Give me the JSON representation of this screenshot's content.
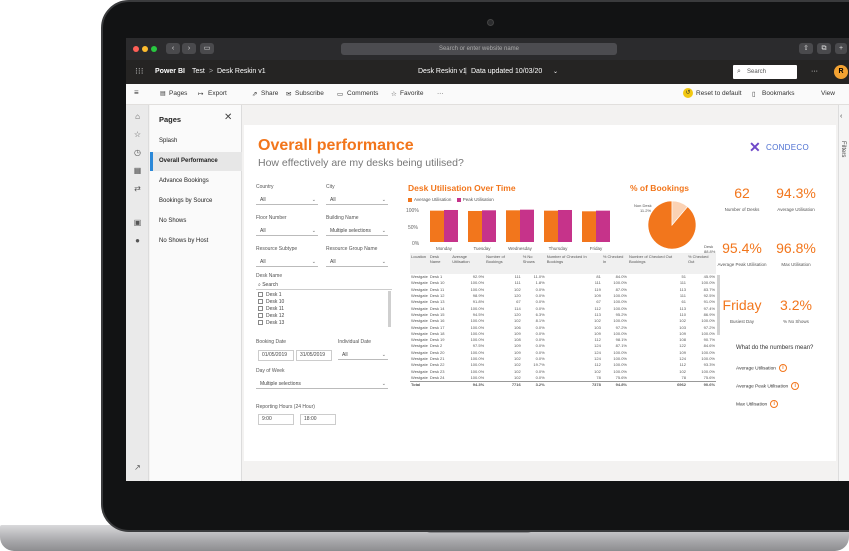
{
  "browser": {
    "address": "Search or enter website name"
  },
  "header": {
    "app": "Power BI",
    "crumb1": "Test",
    "crumb2": "Desk Reskin v1",
    "report": "Desk Reskin v1",
    "updated": "Data updated 10/03/20",
    "search": "Search",
    "avatar": "R"
  },
  "toolbar": {
    "pages": "Pages",
    "export": "Export",
    "share": "Share",
    "subscribe": "Subscribe",
    "comments": "Comments",
    "favorite": "Favorite",
    "more": "···",
    "reset": "Reset to default",
    "bookmarks": "Bookmarks",
    "view": "View"
  },
  "pages_pane": {
    "title": "Pages",
    "items": [
      "Splash",
      "Overall Performance",
      "Advance Bookings",
      "Bookings by Source",
      "No Shows",
      "No Shows by Host"
    ]
  },
  "filters_tab": "Filters",
  "report": {
    "title": "Overall performance",
    "subtitle": "How effectively are my desks being utilised?",
    "brand": "CONDECO"
  },
  "filters": {
    "country": {
      "label": "Country",
      "value": "All"
    },
    "city": {
      "label": "City",
      "value": "All"
    },
    "floor": {
      "label": "Floor Number",
      "value": "All"
    },
    "building": {
      "label": "Building Name",
      "value": "Multiple selections"
    },
    "subtype": {
      "label": "Resource Subtype",
      "value": "All"
    },
    "group": {
      "label": "Resource Group Name",
      "value": "All"
    },
    "desk_name": {
      "label": "Desk Name",
      "search": "Search",
      "items": [
        "Desk 1",
        "Desk 10",
        "Desk 11",
        "Desk 12",
        "Desk 13"
      ]
    },
    "booking_date": {
      "label": "Booking Date",
      "from": "01/05/2019",
      "to": "31/05/2019"
    },
    "individual_date": {
      "label": "Individual Date",
      "value": "All"
    },
    "day_of_week": {
      "label": "Day of Week",
      "value": "Multiple selections"
    },
    "hours": {
      "label": "Reporting Hours (24 Hour)",
      "from": "9:00",
      "to": "18:00"
    }
  },
  "util_chart": {
    "title": "Desk Utilisation Over Time",
    "legend_avg": "Average Utilisation",
    "legend_peak": "Peak Utilisation",
    "yticks": [
      "100%",
      "50%",
      "0%"
    ]
  },
  "bookings_chart": {
    "title": "% of Bookings",
    "label_noshow": "Non Desk",
    "label_noshow_pct": "11.2%",
    "label_desk": "Desk",
    "label_desk_pct": "88.8%"
  },
  "chart_data": [
    {
      "type": "bar",
      "title": "Desk Utilisation Over Time",
      "categories": [
        "Monday",
        "Tuesday",
        "Wednesday",
        "Thursday",
        "Friday"
      ],
      "series": [
        {
          "name": "Average Utilisation",
          "values": [
            95,
            94,
            96,
            95,
            93
          ]
        },
        {
          "name": "Peak Utilisation",
          "values": [
            97,
            96,
            98,
            97,
            95
          ]
        }
      ],
      "ylim": [
        0,
        100
      ],
      "colors": [
        "#f2761c",
        "#c6338a"
      ]
    },
    {
      "type": "pie",
      "title": "% of Bookings",
      "categories": [
        "Non Desk",
        "Desk"
      ],
      "values": [
        11.2,
        88.8
      ],
      "colors": [
        "#fbd2b4",
        "#f2761c"
      ]
    }
  ],
  "kpis": [
    {
      "value": "62",
      "label": "Number of Desks"
    },
    {
      "value": "94.3%",
      "label": "Average Utilisation"
    },
    {
      "value": "95.4%",
      "label": "Average Peak Utilisation"
    },
    {
      "value": "96.8%",
      "label": "Max Utilisation"
    },
    {
      "value": "Friday",
      "label": "Busiest Day"
    },
    {
      "value": "3.2%",
      "label": "% No Shows"
    }
  ],
  "numbers_help": {
    "title": "What do the numbers mean?",
    "items": [
      "Average Utilisation",
      "Average Peak Utilisation",
      "Max Utilisation"
    ]
  },
  "table": {
    "headers": [
      "Location",
      "Desk Name",
      "Average Utilisation",
      "Number of Bookings",
      "% No Shows",
      "Number of Checked In Bookings",
      "% Checked In",
      "Number of Checked Out Bookings",
      "% Checked Out"
    ],
    "rows": [
      [
        "Westgate",
        "Desk 1",
        "92.9%",
        "111",
        "11.0%",
        "81",
        "84.0%",
        "51",
        "45.9%"
      ],
      [
        "Westgate",
        "Desk 10",
        "100.0%",
        "111",
        "1.8%",
        "111",
        "100.0%",
        "111",
        "100.0%"
      ],
      [
        "Westgate",
        "Desk 11",
        "100.0%",
        "102",
        "0.0%",
        "119",
        "87.0%",
        "113",
        "83.7%"
      ],
      [
        "Westgate",
        "Desk 12",
        "98.9%",
        "120",
        "0.0%",
        "109",
        "100.0%",
        "111",
        "92.5%"
      ],
      [
        "Westgate",
        "Desk 13",
        "91.8%",
        "67",
        "0.0%",
        "67",
        "100.0%",
        "61",
        "91.0%"
      ],
      [
        "Westgate",
        "Desk 14",
        "100.0%",
        "114",
        "0.0%",
        "112",
        "100.0%",
        "113",
        "97.4%"
      ],
      [
        "Westgate",
        "Desk 15",
        "94.5%",
        "120",
        "6.3%",
        "113",
        "95.2%",
        "110",
        "86.9%"
      ],
      [
        "Westgate",
        "Desk 16",
        "100.0%",
        "102",
        "8.1%",
        "102",
        "100.0%",
        "102",
        "100.0%"
      ],
      [
        "Westgate",
        "Desk 17",
        "100.0%",
        "106",
        "0.0%",
        "103",
        "97.2%",
        "103",
        "97.2%"
      ],
      [
        "Westgate",
        "Desk 18",
        "100.0%",
        "109",
        "0.0%",
        "109",
        "100.0%",
        "109",
        "100.0%"
      ],
      [
        "Westgate",
        "Desk 19",
        "100.0%",
        "108",
        "0.0%",
        "112",
        "98.1%",
        "108",
        "90.7%"
      ],
      [
        "Westgate",
        "Desk 2",
        "97.5%",
        "109",
        "0.0%",
        "124",
        "87.1%",
        "122",
        "84.6%"
      ],
      [
        "Westgate",
        "Desk 20",
        "100.0%",
        "109",
        "0.0%",
        "124",
        "100.0%",
        "109",
        "100.0%"
      ],
      [
        "Westgate",
        "Desk 21",
        "100.0%",
        "102",
        "0.0%",
        "124",
        "100.0%",
        "124",
        "100.0%"
      ],
      [
        "Westgate",
        "Desk 22",
        "100.0%",
        "102",
        "19.7%",
        "112",
        "100.0%",
        "112",
        "93.3%"
      ],
      [
        "Westgate",
        "Desk 23",
        "100.0%",
        "102",
        "0.0%",
        "102",
        "100.0%",
        "102",
        "100.0%"
      ],
      [
        "Westgate",
        "Desk 24",
        "100.0%",
        "102",
        "0.0%",
        "78",
        "75.6%",
        "78",
        "75.6%"
      ]
    ],
    "total": [
      "Total",
      "",
      "94.3%",
      "7716",
      "3.2%",
      "7378",
      "94.8%",
      "6962",
      "90.6%"
    ]
  }
}
